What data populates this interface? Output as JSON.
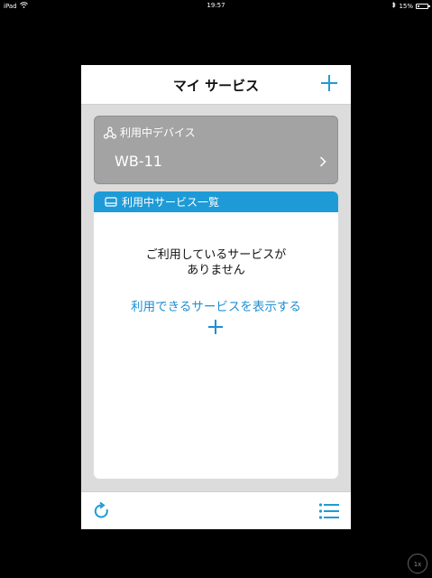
{
  "status_bar": {
    "carrier": "iPad",
    "time": "19:57",
    "battery": "15%",
    "battery_level": 0.15
  },
  "navbar": {
    "title": "マイ サービス",
    "add_icon": "plus-icon"
  },
  "device_section": {
    "header": "利用中デバイス",
    "header_icon": "network-nodes-icon",
    "device_name": "WB-11",
    "chevron_icon": "chevron-right-icon"
  },
  "services_section": {
    "header": "利用中サービス一覧",
    "header_icon": "device-icon",
    "empty_message_line1": "ご利用しているサービスが",
    "empty_message_line2": "ありません",
    "show_available_link": "利用できるサービスを表示する",
    "add_icon": "plus-icon"
  },
  "toolbar": {
    "refresh_icon": "refresh-icon",
    "menu_icon": "list-icon"
  },
  "zoom_badge": "1x",
  "colors": {
    "accent": "#1e9bd7",
    "link": "#1e8fd1",
    "device_card": "#a3a3a3"
  }
}
